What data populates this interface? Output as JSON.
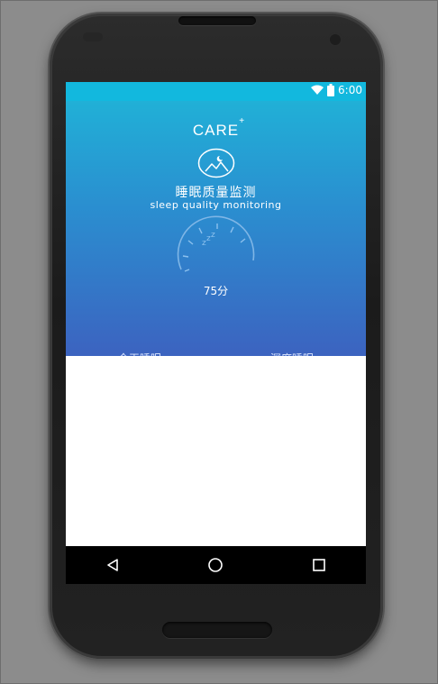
{
  "status_bar": {
    "time": "6:00",
    "icons": [
      "wifi-icon",
      "battery-icon"
    ]
  },
  "app": {
    "brand": "CARE",
    "brand_superscript": "+",
    "logo_icon": "moon-mountain-icon",
    "title_cn": "睡眠质量监测",
    "title_en": "sleep quality monitoring",
    "gauge_icon": "zzz-icon",
    "score": "75分"
  },
  "tabs": {
    "left": "今天睡眠",
    "right": "深度睡眠"
  },
  "navbar": {
    "buttons": [
      "back-icon",
      "home-icon",
      "recents-icon"
    ]
  },
  "colors": {
    "status_bar": "#12b8de",
    "hero_top": "#1fb6d8",
    "hero_bottom": "#3c63c0",
    "frame_bg": "#8c8c8c",
    "nav_bg": "#000000"
  }
}
